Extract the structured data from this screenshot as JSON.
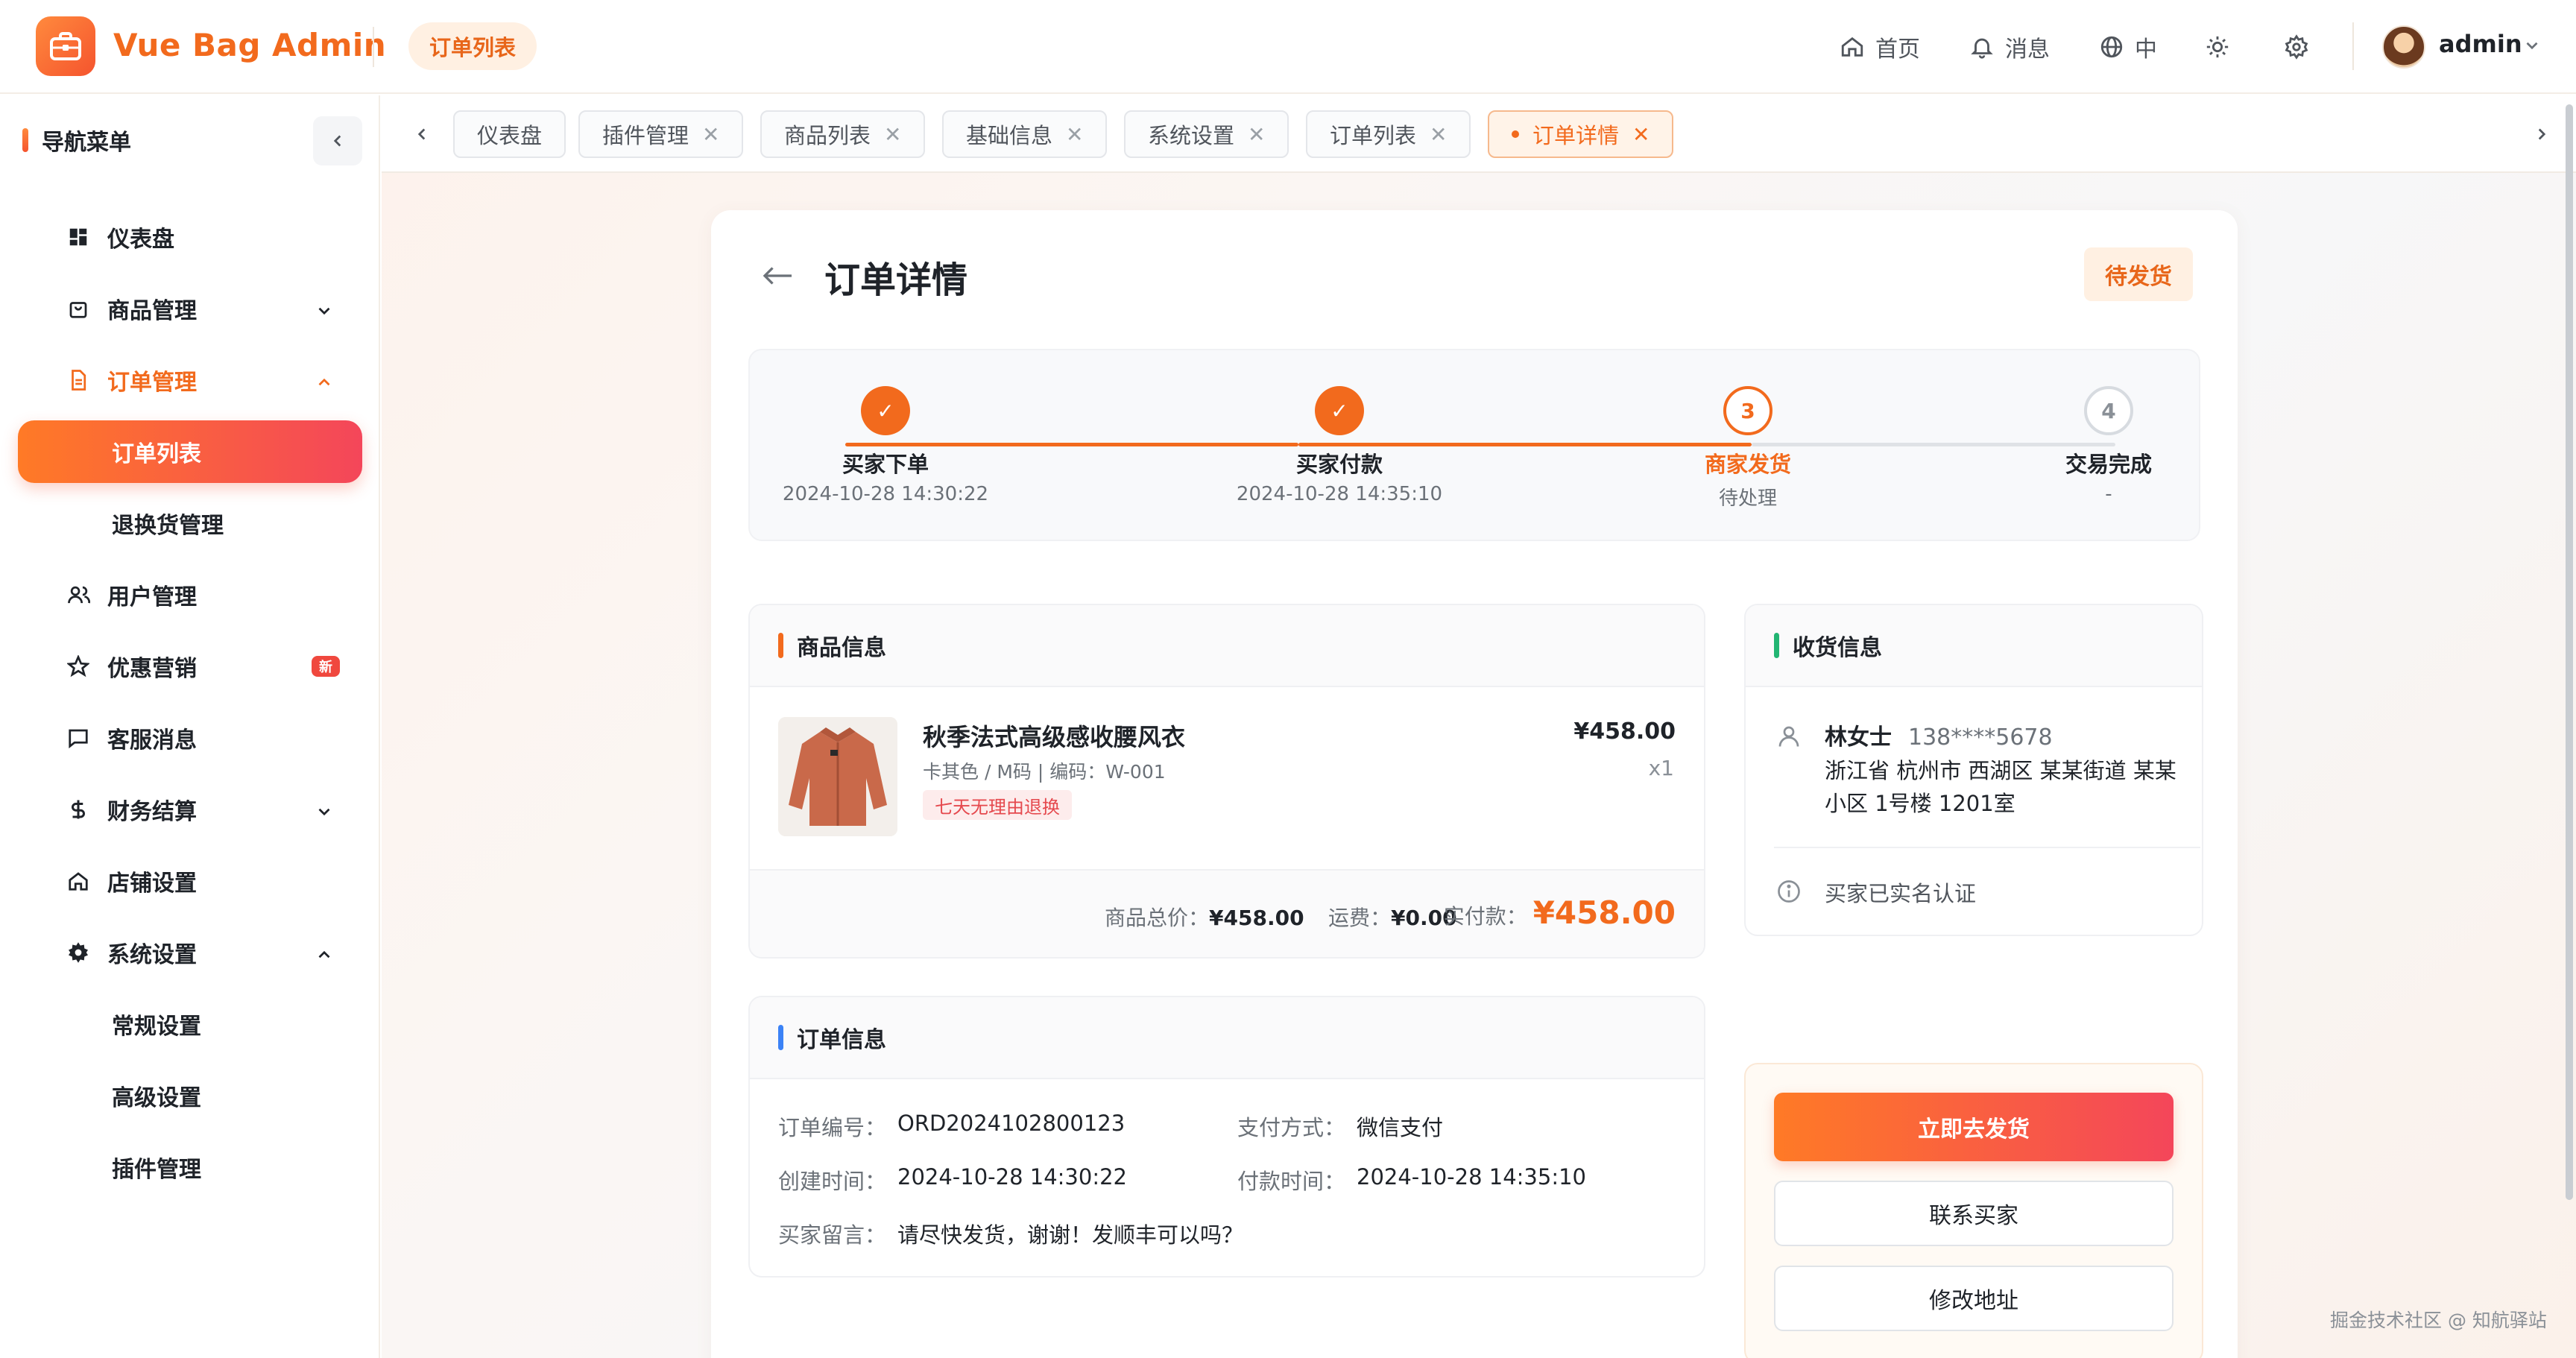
{
  "header": {
    "app_title": "Vue Bag Admin",
    "current_page_pill": "订单列表",
    "home_label": "首页",
    "messages_label": "消息",
    "language_label": "中",
    "user_name": "admin"
  },
  "sidebar": {
    "nav_title": "导航菜单",
    "items": [
      {
        "label": "仪表盘"
      },
      {
        "label": "商品管理"
      },
      {
        "label": "订单管理"
      },
      {
        "label": "订单列表"
      },
      {
        "label": "退换货管理"
      },
      {
        "label": "用户管理"
      },
      {
        "label": "优惠营销",
        "badge": "新"
      },
      {
        "label": "客服消息"
      },
      {
        "label": "财务结算"
      },
      {
        "label": "店铺设置"
      },
      {
        "label": "系统设置"
      },
      {
        "label": "常规设置"
      },
      {
        "label": "高级设置"
      },
      {
        "label": "插件管理"
      }
    ]
  },
  "tabs": [
    {
      "label": "仪表盘"
    },
    {
      "label": "插件管理"
    },
    {
      "label": "商品列表"
    },
    {
      "label": "基础信息"
    },
    {
      "label": "系统设置"
    },
    {
      "label": "订单列表"
    },
    {
      "label": "订单详情"
    }
  ],
  "page": {
    "title": "订单详情",
    "status": "待发货"
  },
  "steps": [
    {
      "title": "买家下单",
      "sub": "2024-10-28 14:30:22",
      "mark": "✓"
    },
    {
      "title": "买家付款",
      "sub": "2024-10-28 14:35:10",
      "mark": "✓"
    },
    {
      "title": "商家发货",
      "sub": "待处理",
      "mark": "3"
    },
    {
      "title": "交易完成",
      "sub": "-",
      "mark": "4"
    }
  ],
  "product_panel": {
    "title": "商品信息",
    "name": "秋季法式高级感收腰风衣",
    "spec": "卡其色 / M码 | 编码：W-001",
    "tag": "七天无理由退换",
    "price": "¥458.00",
    "qty": "x1",
    "total_label": "商品总价：",
    "total_value": "¥458.00",
    "shipping_label": "运费：",
    "shipping_value": "¥0.00",
    "paid_label": "实付款：",
    "paid_value": "¥458.00"
  },
  "receiver_panel": {
    "title": "收货信息",
    "name": "林女士",
    "phone": "138****5678",
    "address": "浙江省 杭州市 西湖区 某某街道 某某小区 1号楼 1201室",
    "verify": "买家已实名认证"
  },
  "order_panel": {
    "title": "订单信息",
    "order_no_label": "订单编号：",
    "order_no": "ORD2024102800123",
    "pay_method_label": "支付方式：",
    "pay_method": "微信支付",
    "created_label": "创建时间：",
    "created": "2024-10-28 14:30:22",
    "paid_time_label": "付款时间：",
    "paid_time": "2024-10-28 14:35:10",
    "remark_label": "买家留言：",
    "remark": "请尽快发货，谢谢！发顺丰可以吗？"
  },
  "actions": {
    "ship_now": "立即去发货",
    "contact_buyer": "联系买家",
    "edit_address": "修改地址"
  },
  "watermark": "掘金技术社区 @ 知航驿站",
  "colors": {
    "accent": "#f26a1d",
    "gradient_start": "#ff7a26",
    "gradient_end": "#f4465a",
    "product_bar": "#f26a1d",
    "receiver_bar": "#22b573",
    "order_bar": "#3b82f6"
  }
}
